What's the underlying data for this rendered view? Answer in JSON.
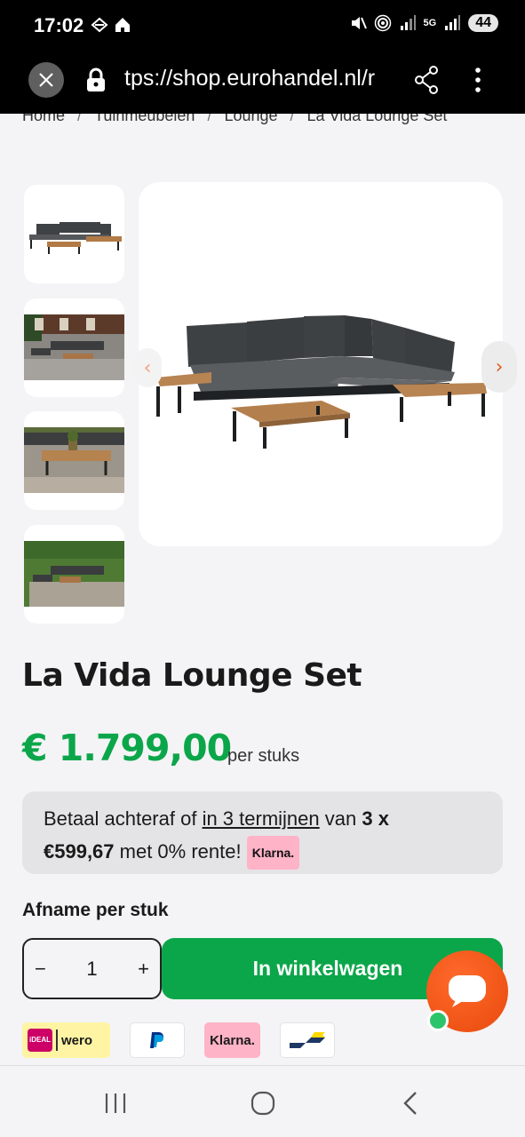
{
  "status_bar": {
    "time": "17:02",
    "network": "5G",
    "battery": "44"
  },
  "browser": {
    "url": "tps://shop.eurohandel.nl/r"
  },
  "breadcrumb": {
    "items": [
      "Home",
      "Tuinmeubelen",
      "Lounge",
      "La Vida Lounge Set"
    ],
    "separator": "/"
  },
  "product": {
    "title": "La Vida Lounge Set",
    "price": "€ 1.799,00",
    "price_unit": "per stuks"
  },
  "klarna": {
    "text_1": "Betaal achteraf of ",
    "link": "in 3 termijnen",
    "text_2": " van ",
    "amount_prefix": "3 x",
    "amount": "€599,67",
    "text_3": " met 0% rente! ",
    "badge": "Klarna."
  },
  "order": {
    "label": "Afname per stuk",
    "qty_minus": "−",
    "qty_value": "1",
    "qty_plus": "+",
    "add_to_cart": "In winkelwagen"
  },
  "payment": {
    "ideal": "iDEAL",
    "wero": "wero",
    "klarna": "Klarna."
  },
  "colors": {
    "accent_green": "#0ca64a",
    "chat_orange": "#ee5516",
    "klarna_pink": "#ffb3c7"
  }
}
